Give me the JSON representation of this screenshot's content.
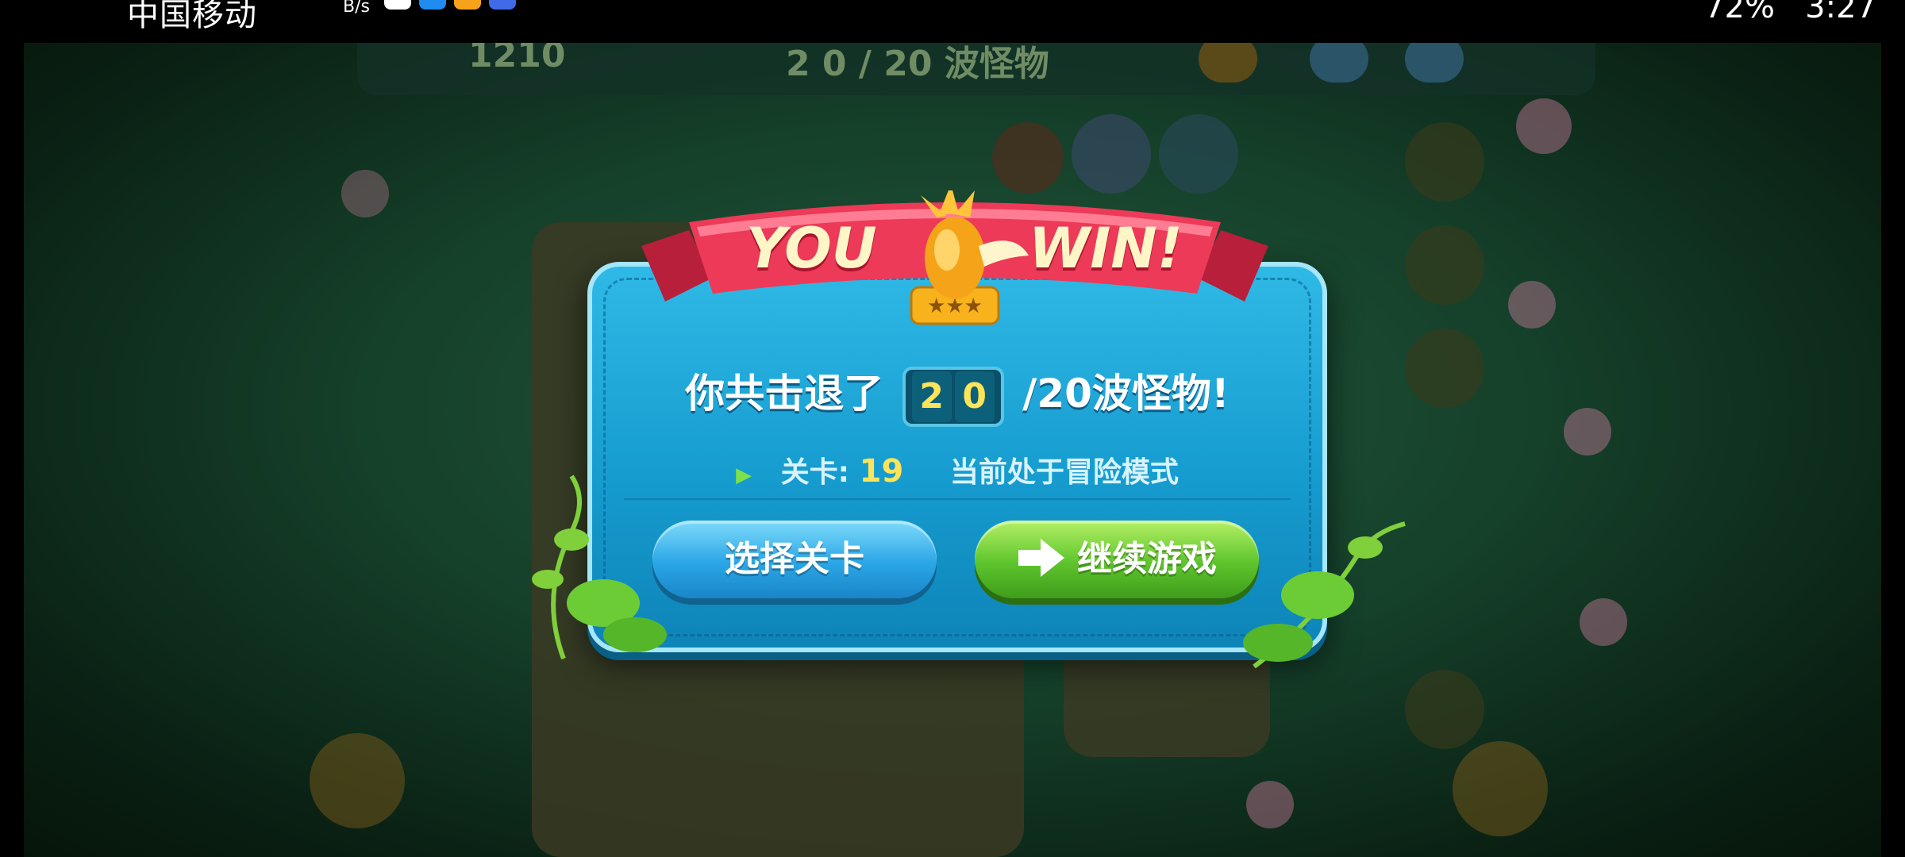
{
  "status_bar": {
    "carrier": "中国移动",
    "net_speed_unit": "B/s",
    "battery": "72%",
    "time": "3:27"
  },
  "hud": {
    "gold": "1210",
    "waves": "2 0 / 20 波怪物"
  },
  "result": {
    "banner_left": "YOU",
    "banner_right": "WIN!",
    "defeated_prefix": "你共击退了",
    "defeated_digits": [
      "2",
      "0"
    ],
    "defeated_suffix": "/20波怪物!",
    "level_label": "关卡:",
    "level_value": "19",
    "mode_text": "当前处于冒险模式",
    "select_level_button": "选择关卡",
    "continue_button": "继续游戏"
  },
  "colors": {
    "dialog": "#169ccf",
    "ribbon": "#e8334f",
    "accent_yellow": "#ffe35a",
    "button_green": "#5ec42c",
    "button_blue": "#2aa6e6"
  }
}
